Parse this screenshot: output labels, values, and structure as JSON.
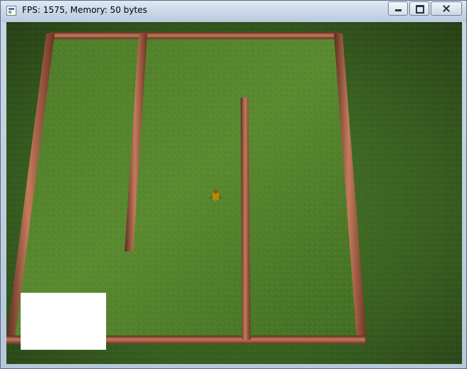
{
  "window": {
    "title": "FPS: 1575, Memory: 50 bytes",
    "icon": "app-window-icon",
    "controls": [
      "minimize-icon",
      "maximize-icon",
      "close-icon"
    ]
  },
  "scene": {
    "colors": {
      "background_grass": "#3f6b26",
      "field_grass": "#4f7f2a",
      "wall_wood": "#8a4a33",
      "wall_highlight": "#c07a5e",
      "player": "#b8860b",
      "overlay_box": "#ffffff"
    },
    "objects": [
      "grass-field",
      "maze-walls",
      "player-bug",
      "white-overlay-box"
    ]
  }
}
